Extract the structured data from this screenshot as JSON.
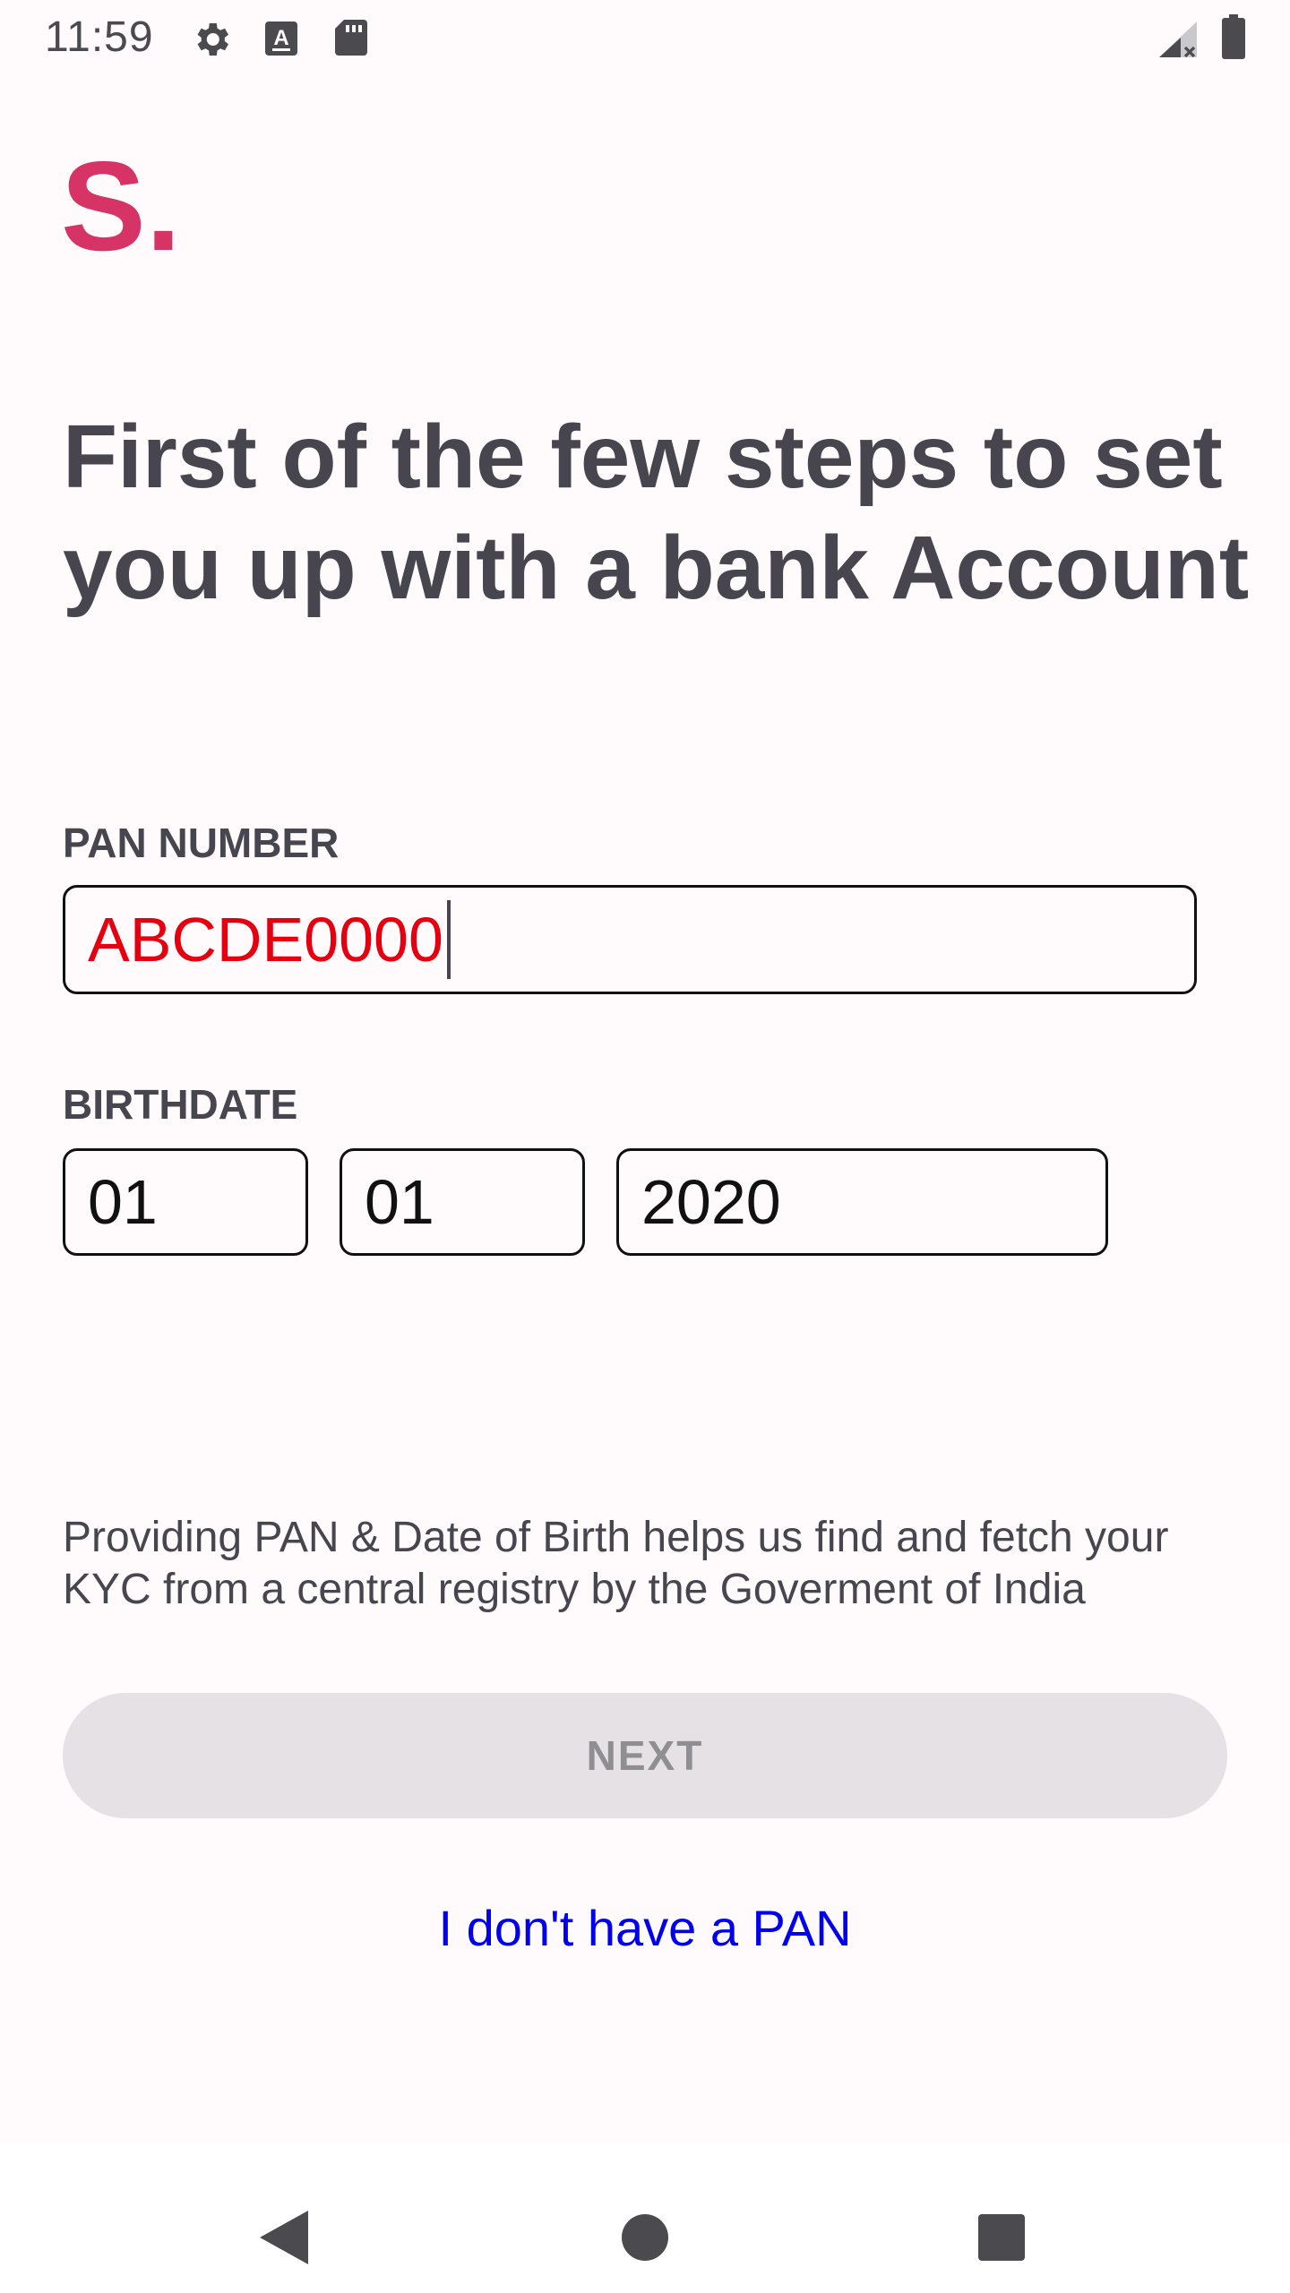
{
  "status_bar": {
    "time": "11:59",
    "icons": [
      "gear-icon",
      "keyboard-a-icon",
      "sd-card-icon",
      "signal-no-data-icon",
      "battery-icon"
    ]
  },
  "brand": {
    "logo_text": "S."
  },
  "headline": "First of the few steps to set you up with a bank Account",
  "pan": {
    "label": "PAN NUMBER",
    "value": "ABCDE0000"
  },
  "birthdate": {
    "label": "BIRTHDATE",
    "day": "01",
    "month": "01",
    "year": "2020"
  },
  "info_text": "Providing PAN & Date of Birth helps us find and fetch your KYC from a central registry by the Goverment of India",
  "next_button": {
    "label": "NEXT",
    "enabled": false
  },
  "no_pan_link": "I don't have a PAN",
  "nav_bar": {
    "icons": [
      "back-icon",
      "home-icon",
      "recents-icon"
    ]
  },
  "colors": {
    "brand": "#d63467",
    "headline": "#47464e",
    "pan_value_error": "#e5000f",
    "link": "#0000ee",
    "button_disabled_bg": "#e5e1e4",
    "button_disabled_text": "#8f8f93",
    "background": "#fffbfd"
  }
}
